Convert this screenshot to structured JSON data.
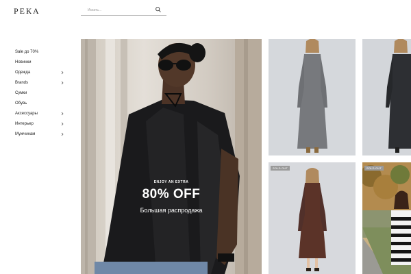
{
  "brand": {
    "logo": "РЕКА"
  },
  "search": {
    "placeholder": "Искать..."
  },
  "sidebar": {
    "items": [
      {
        "label": "Sale до 70%",
        "has_submenu": false
      },
      {
        "label": "Новинки",
        "has_submenu": false
      },
      {
        "label": "Одежда",
        "has_submenu": true
      },
      {
        "label": "Brands",
        "has_submenu": true
      },
      {
        "label": "Сумки",
        "has_submenu": false
      },
      {
        "label": "Обувь",
        "has_submenu": false
      },
      {
        "label": "Аксессуары",
        "has_submenu": true
      },
      {
        "label": "Интерьер",
        "has_submenu": true
      },
      {
        "label": "Мужчинам",
        "has_submenu": true
      }
    ]
  },
  "hero": {
    "eyebrow": "ENJOY AN EXTRA",
    "headline": "80% OFF",
    "subheadline": "Большая распродажа"
  },
  "products": [
    {
      "name": "grey-knit-dress",
      "badge": ""
    },
    {
      "name": "black-knit-dress",
      "badge": ""
    },
    {
      "name": "brown-knit-dress",
      "badge": "SOLD OUT"
    },
    {
      "name": "striped-sweater-outdoor",
      "badge": "SOLD OUT"
    }
  ],
  "colors": {
    "background": "#ffffff",
    "text": "#222222",
    "badge": "#9a9a9a",
    "hero_text": "#ffffff"
  }
}
